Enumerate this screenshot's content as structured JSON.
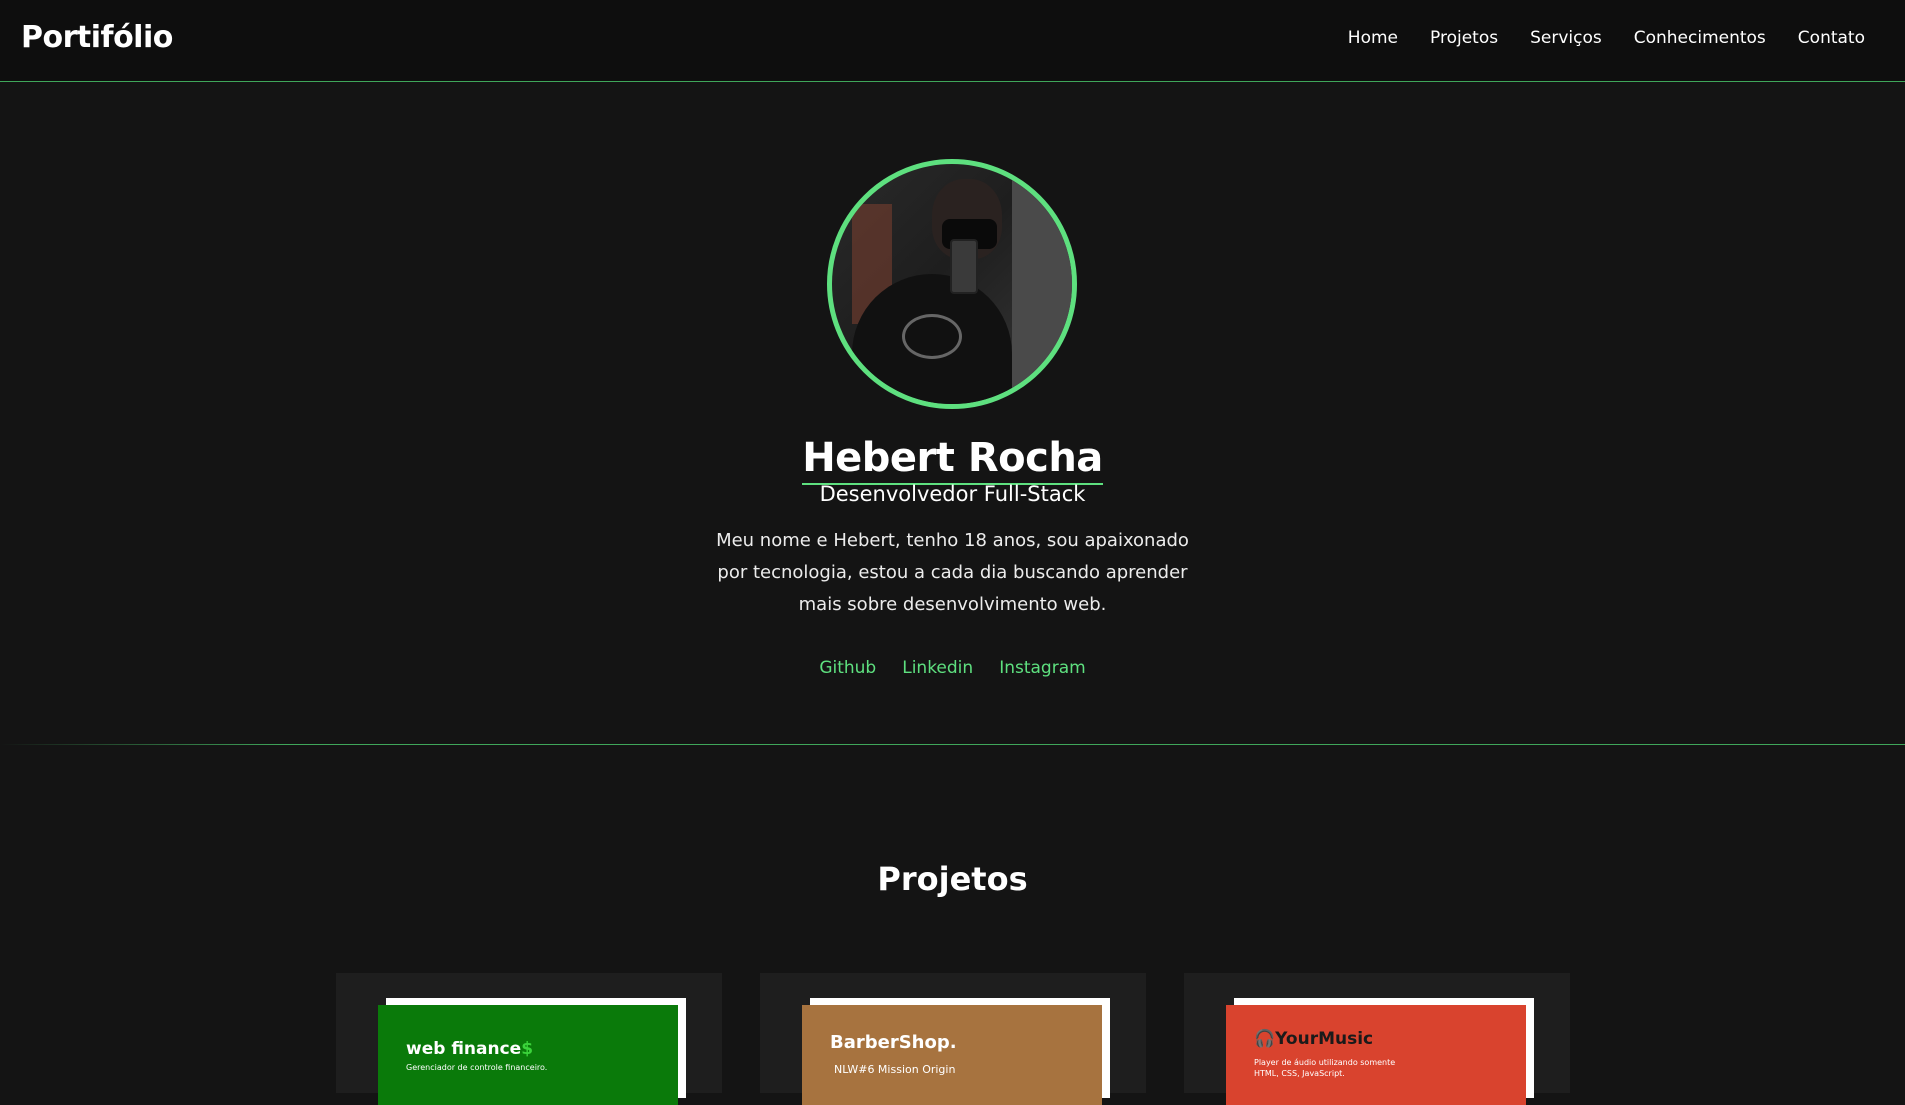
{
  "header": {
    "brand": "Portifólio",
    "nav": [
      "Home",
      "Projetos",
      "Serviços",
      "Conhecimentos",
      "Contato"
    ]
  },
  "hero": {
    "name": "Hebert Rocha",
    "role": "Desenvolvedor Full-Stack",
    "bio": "Meu nome e Hebert, tenho 18 anos, sou apaixonado por tecnologia, estou a cada dia buscando aprender mais sobre desenvolvimento web.",
    "socials": [
      "Github",
      "Linkedin",
      "Instagram"
    ]
  },
  "projects": {
    "title": "Projetos",
    "cards": [
      {
        "title": "web finance",
        "title_suffix": "$",
        "subtitle": "Gerenciador de controle financeiro."
      },
      {
        "title": "BarberShop",
        "title_suffix": ".",
        "subtitle": "NLW#6 Mission Origin"
      },
      {
        "title": "YourMusic",
        "title_suffix": "",
        "subtitle": "Player de áudio utilizando somente HTML, CSS, JavaScript."
      }
    ]
  },
  "colors": {
    "background": "#141414",
    "header": "#0e0e0e",
    "accent": "#5ee07f",
    "card": "#1e1e1e"
  }
}
